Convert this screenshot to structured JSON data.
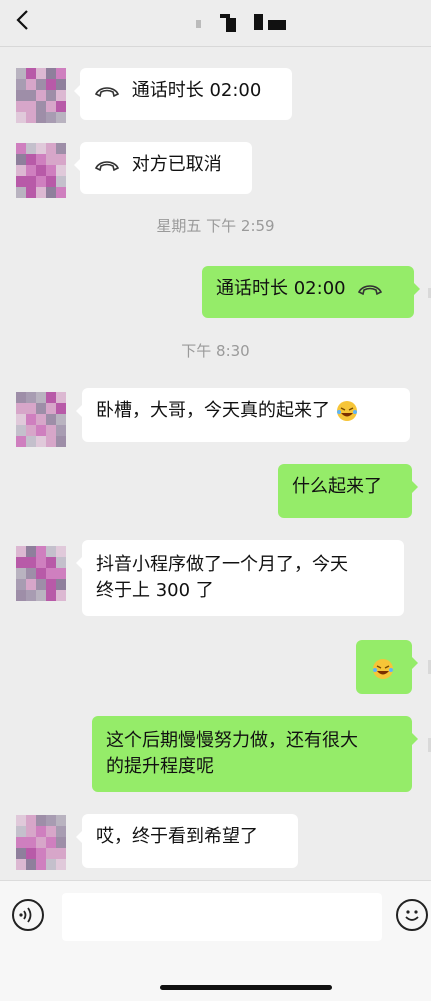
{
  "header": {
    "back_icon": "chevron-left-icon",
    "contact_name_redacted": true
  },
  "messages": [
    {
      "side": "left",
      "type": "call",
      "text": "通话时长  02:00",
      "icon": "phone-hangup-icon"
    },
    {
      "side": "left",
      "type": "call",
      "text": "对方已取消",
      "icon": "phone-hangup-icon"
    },
    {
      "type": "timestamp",
      "text": "星期五 下午 2:59"
    },
    {
      "side": "right",
      "type": "call",
      "text": "通话时长  02:00",
      "icon": "phone-hangup-icon"
    },
    {
      "type": "timestamp",
      "text": "下午 8:30"
    },
    {
      "side": "left",
      "type": "text",
      "text": "卧槽，大哥，今天真的起来了",
      "emoji": "laughing-emoji"
    },
    {
      "side": "right",
      "type": "text",
      "text": "什么起来了"
    },
    {
      "side": "left",
      "type": "text",
      "line1": "抖音小程序做了一个月了，今天",
      "line2": "终于上 300 了"
    },
    {
      "side": "right",
      "type": "emoji",
      "emoji": "laughing-emoji"
    },
    {
      "side": "right",
      "type": "text",
      "line1": "这个后期慢慢努力做，还有很大",
      "line2": "的提升程度呢"
    },
    {
      "side": "left",
      "type": "text",
      "text": "哎，终于看到希望了"
    }
  ],
  "input": {
    "voice_icon": "voice-icon",
    "emoji_icon": "smiley-icon",
    "value": ""
  },
  "colors": {
    "background": "#ededed",
    "incoming_bubble": "#ffffff",
    "outgoing_bubble": "#95ec69",
    "timestamp_text": "#9a9a9a"
  }
}
